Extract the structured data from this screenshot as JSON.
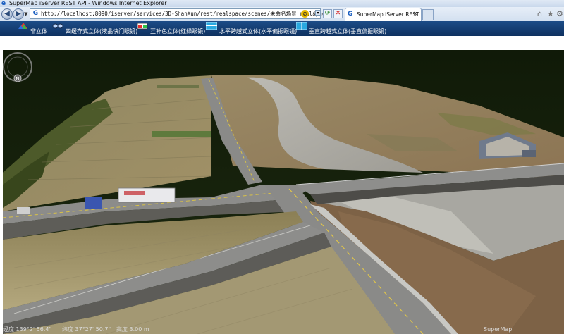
{
  "window": {
    "title": "SuperMap iServer REST API - Windows Internet Explorer"
  },
  "browser": {
    "url": "http://localhost:8090/iserver/services/3D-ShanXun/rest/realspace/scenes/未命名场景 realspace",
    "tab_title": "SuperMap iServer REST ...",
    "tab_close": "×",
    "icons": {
      "back": "back-arrow-icon",
      "forward": "forward-arrow-icon",
      "refresh": "refresh-icon",
      "stop": "stop-icon",
      "home": "home-icon",
      "favorites": "star-icon",
      "tools": "gear-icon"
    }
  },
  "toolbar": {
    "items": [
      {
        "label": "非立体",
        "icon": "mono-view-icon"
      },
      {
        "label": "四缓存式立体(液晶快门眼镜)",
        "icon": "shutter-glasses-icon"
      },
      {
        "label": "互补色立体(红绿眼镜)",
        "icon": "anaglyph-glasses-icon"
      },
      {
        "label": "水平跨越式立体(水平偏振眼镜)",
        "icon": "horizontal-polarized-icon"
      },
      {
        "label": "垂直跨越式立体(垂直偏振眼镜)",
        "icon": "vertical-polarized-icon"
      }
    ]
  },
  "scene": {
    "compass_label": "N"
  },
  "status": {
    "longitude": "经度 139°2' 56.4\"",
    "latitude": "纬度 37°27' 50.7\"",
    "altitude": "高度 3.00 m",
    "credit": "SuperMap"
  },
  "colors": {
    "toolbar_bg": "#123e74",
    "sky": "#0f1a06",
    "road": "#8a8a88",
    "field": "#9a8a62"
  }
}
